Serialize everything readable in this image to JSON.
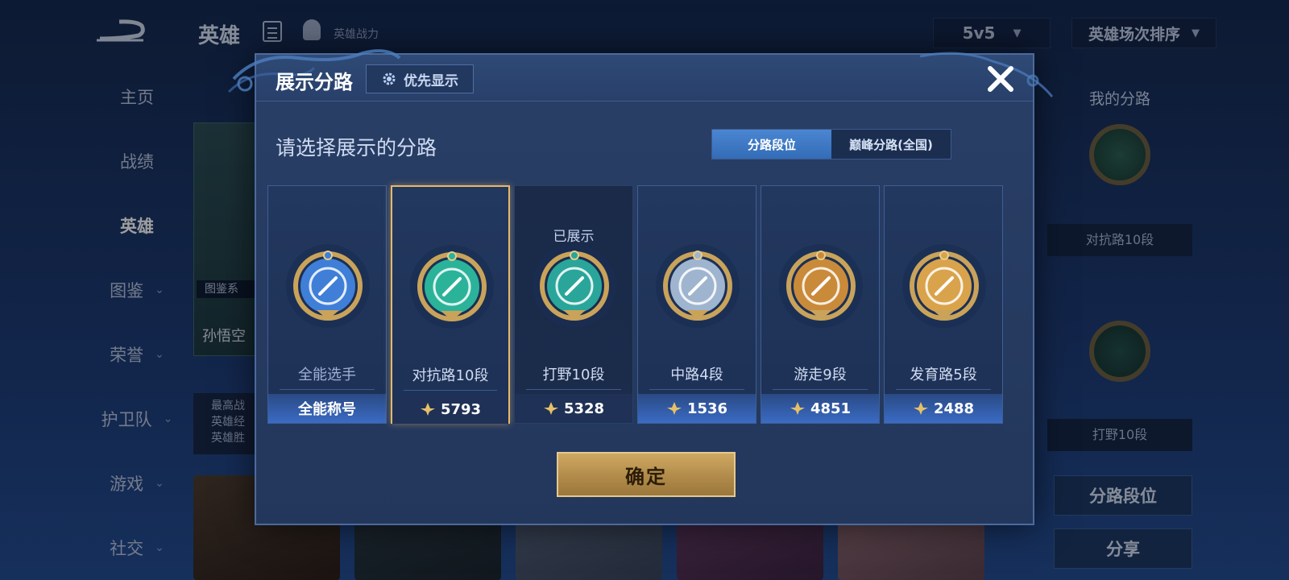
{
  "background": {
    "title": "英雄",
    "power_label": "英雄战力",
    "mode_value": "5v5",
    "sort_value": "英雄场次排序",
    "nav": [
      {
        "label": "主页"
      },
      {
        "label": "战绩"
      },
      {
        "label": "英雄"
      },
      {
        "label": "图鉴"
      },
      {
        "label": "荣誉"
      },
      {
        "label": "护卫队"
      },
      {
        "label": "游戏"
      },
      {
        "label": "社交"
      }
    ],
    "hero_card": {
      "name": "孙悟空",
      "tag": "图鉴系"
    },
    "hero_stats": [
      "最高战",
      "英雄经",
      "英雄胜"
    ],
    "right_panel": {
      "title": "我的分路",
      "lane1": "对抗路10段",
      "lane2": "打野10段",
      "btn_lane_rank": "分路段位",
      "btn_share": "分享"
    }
  },
  "modal": {
    "title": "展示分路",
    "priority_label": "优先显示",
    "subtitle": "请选择展示的分路",
    "tabs": [
      {
        "label": "分路段位",
        "active": true
      },
      {
        "label": "巅峰分路(全国)",
        "active": false
      }
    ],
    "lanes": [
      {
        "name": "全能选手",
        "footer": "全能称号",
        "score": null,
        "badge": "allround-badge-icon",
        "color": "#3f7fd8",
        "shown": false,
        "selected": false
      },
      {
        "name": "对抗路10段",
        "footer": null,
        "score": "5793",
        "badge": "clash-lane-badge-icon",
        "color": "#2bb39a",
        "shown": false,
        "selected": true
      },
      {
        "name": "打野10段",
        "footer": null,
        "score": "5328",
        "badge": "jungle-badge-icon",
        "color": "#2aa59a",
        "shown": true,
        "shown_label": "已展示",
        "selected": false
      },
      {
        "name": "中路4段",
        "footer": null,
        "score": "1536",
        "badge": "mid-lane-badge-icon",
        "color": "#9fb4cf",
        "shown": false,
        "selected": false
      },
      {
        "name": "游走9段",
        "footer": null,
        "score": "4851",
        "badge": "roam-badge-icon",
        "color": "#c98a3a",
        "shown": false,
        "selected": false
      },
      {
        "name": "发育路5段",
        "footer": null,
        "score": "2488",
        "badge": "farm-lane-badge-icon",
        "color": "#d9a34b",
        "shown": false,
        "selected": false
      }
    ],
    "confirm_label": "确定"
  }
}
